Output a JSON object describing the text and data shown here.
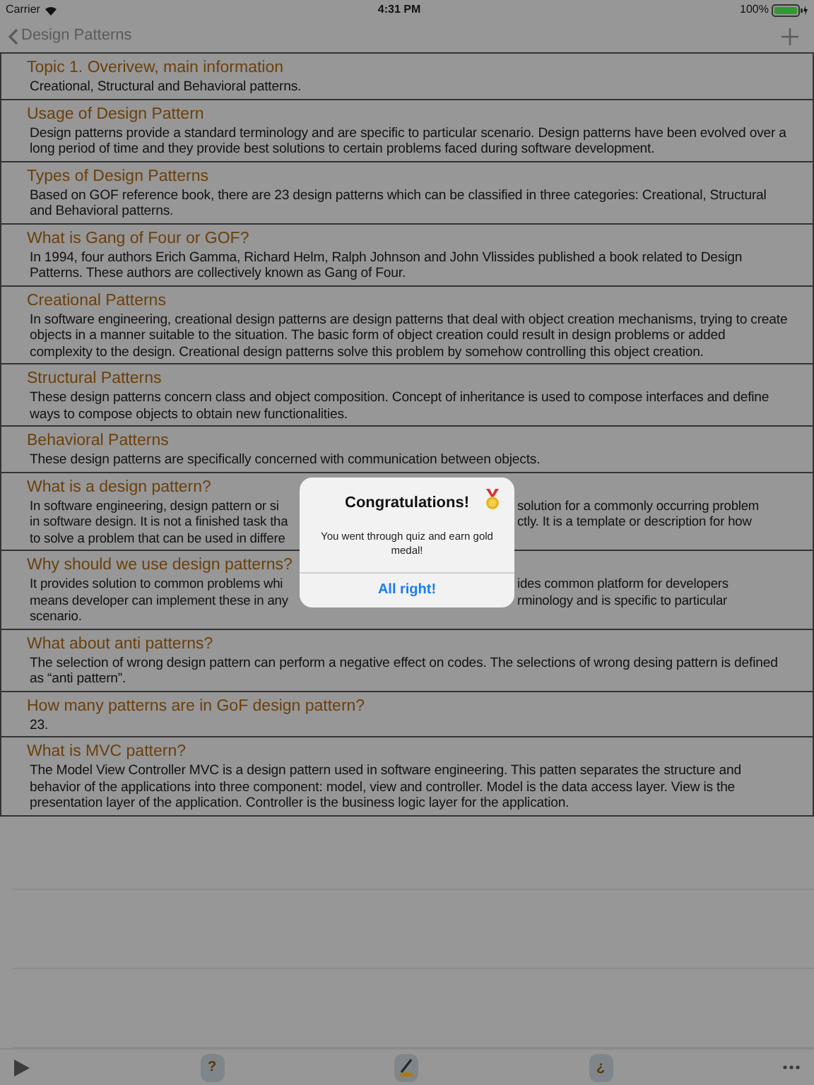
{
  "status_bar": {
    "carrier": "Carrier",
    "time": "4:31 PM",
    "battery": "100%"
  },
  "nav": {
    "back_label": "Design Patterns"
  },
  "topics": [
    {
      "title": "Topic 1. Overivew, main information",
      "body": "Creational, Structural and Behavioral patterns."
    },
    {
      "title": "Usage of Design Pattern",
      "body": "Design patterns provide a standard terminology and are specific to particular scenario. Design patterns have been evolved over a long period of time and they provide best solutions to certain problems faced during software development."
    },
    {
      "title": "Types of Design Patterns",
      "body": "Based on GOF reference book, there are 23 design patterns which can be classified in three categories: Creational, Structural and Behavioral patterns."
    },
    {
      "title": "What is Gang of Four or GOF?",
      "body": "In 1994, four authors Erich Gamma, Richard Helm, Ralph Johnson and John Vlissides published a book related to Design Patterns. These authors are collectively known as Gang of Four."
    },
    {
      "title": "Creational Patterns",
      "body": "In software engineering, creational design patterns are design patterns that deal with object creation mechanisms, trying to create objects in a manner suitable to the situation. The basic form of object creation could result in design problems or added complexity to the design. Creational design patterns solve this problem by somehow controlling this object creation."
    },
    {
      "title": "Structural Patterns",
      "body": "These design patterns concern class and object composition. Concept of inheritance is used to compose interfaces and define ways to compose objects to obtain new functionalities."
    },
    {
      "title": "Behavioral Patterns",
      "body": "These design patterns are specifically concerned with communication between objects."
    },
    {
      "title": "What is a design pattern?",
      "body_lines": [
        {
          "left": "In software engineering, design pattern or si",
          "right": "solution for a commonly occurring problem"
        },
        {
          "left": "in software design. It is not a finished task tha",
          "right": "ctly. It is a template or description for how"
        },
        {
          "left": "to solve a problem that can be used in differe"
        }
      ]
    },
    {
      "title": "Why should we use design patterns?",
      "body_lines": [
        {
          "left": "It provides solution to common problems whi",
          "right": "ides common platform for developers"
        },
        {
          "left": "means developer can implement these in any",
          "right": "rminology and is specific to particular"
        },
        {
          "left": "scenario."
        }
      ]
    },
    {
      "title": "What about anti patterns?",
      "body": "The selection of wrong design pattern can perform a negative effect on codes. The selections of wrong desing pattern is defined as “anti pattern”."
    },
    {
      "title": "How many patterns are in GoF design pattern?",
      "body": "23."
    },
    {
      "title": "What is MVC pattern?",
      "body": "The Model View Controller MVC is a design pattern used in software engineering. This patten separates the structure and behavior of the applications into three component: model, view and controller. Model is the data access layer. View is the presentation layer of the application. Controller is the business logic layer for the application."
    }
  ],
  "toolbar": [
    {
      "kind": "play"
    },
    {
      "kind": "char",
      "label": "?"
    },
    {
      "kind": "pen"
    },
    {
      "kind": "char",
      "label": "¿"
    },
    {
      "kind": "more"
    }
  ],
  "alert": {
    "title": "Congratulations!",
    "message": "You went through quiz and earn gold medal!",
    "button": "All right!"
  }
}
